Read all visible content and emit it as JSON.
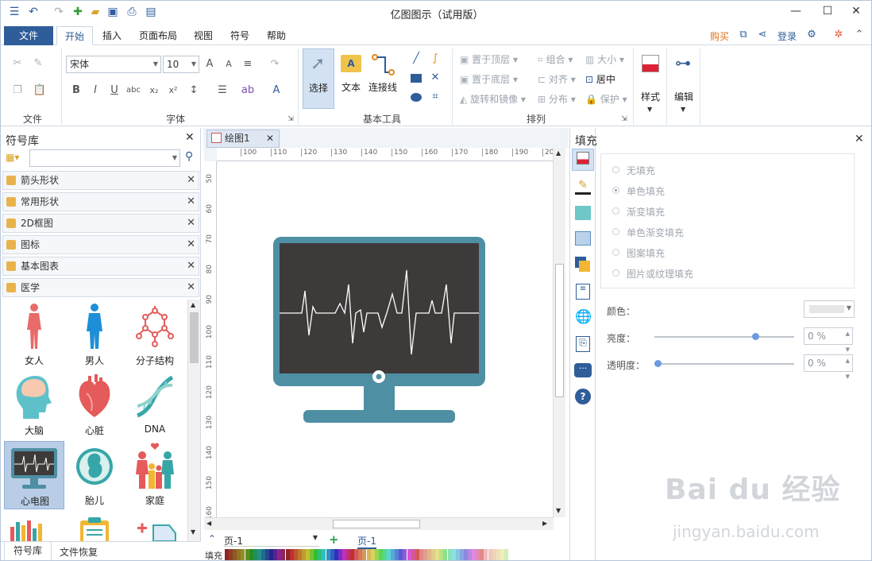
{
  "window": {
    "title": "亿图图示（试用版）"
  },
  "tabs": {
    "file": "文件",
    "items": [
      "开始",
      "插入",
      "页面布局",
      "视图",
      "符号",
      "帮助"
    ],
    "buy": "购买",
    "login": "登录"
  },
  "ribbon": {
    "groups": [
      "文件",
      "字体",
      "基本工具",
      "排列"
    ],
    "font_name": "宋体",
    "font_size": "10",
    "tools": {
      "select": "选择",
      "text": "文本",
      "connector": "连接线"
    },
    "arrange": [
      "置于顶层",
      "置于底层",
      "旋转和镜像",
      "组合",
      "对齐",
      "分布",
      "大小",
      "居中",
      "保护"
    ],
    "style": "样式",
    "edit": "编辑"
  },
  "library": {
    "title": "符号库",
    "search_placeholder": "",
    "categories": [
      "箭头形状",
      "常用形状",
      "2D框图",
      "图标",
      "基本图表",
      "医学"
    ],
    "symbols": [
      "女人",
      "男人",
      "分子结构",
      "大脑",
      "心脏",
      "DNA",
      "心电图",
      "胎儿",
      "家庭"
    ],
    "bottom_tabs": [
      "符号库",
      "文件恢复"
    ]
  },
  "document": {
    "tab": "绘图1",
    "page_dropdown": "页-1",
    "page_tab": "页-1",
    "fill_label": "填充",
    "ruler_h": [
      "100",
      "110",
      "120",
      "130",
      "140",
      "150",
      "160",
      "170",
      "180",
      "190",
      "200"
    ],
    "ruler_v": [
      "50",
      "60",
      "70",
      "80",
      "90",
      "100",
      "110",
      "120",
      "130",
      "140",
      "150",
      "160"
    ]
  },
  "fill_panel": {
    "title": "填充",
    "options": [
      "无填充",
      "单色填充",
      "渐变填充",
      "单色渐变填充",
      "图案填充",
      "图片或纹理填充"
    ],
    "selected": "单色填充",
    "color_label": "颜色：",
    "brightness_label": "亮度：",
    "transparency_label": "透明度：",
    "brightness_value": "0 %",
    "transparency_value": "0 %",
    "brightness_level": 0.72,
    "transparency_level": 0.0
  },
  "watermark": {
    "line1": "Bai du 经验",
    "line2": "jingyan.baidu.com"
  },
  "colors": {
    "accent": "#2e5d99",
    "monitor": "#4e8fa3",
    "screen": "#3e3a3a"
  }
}
